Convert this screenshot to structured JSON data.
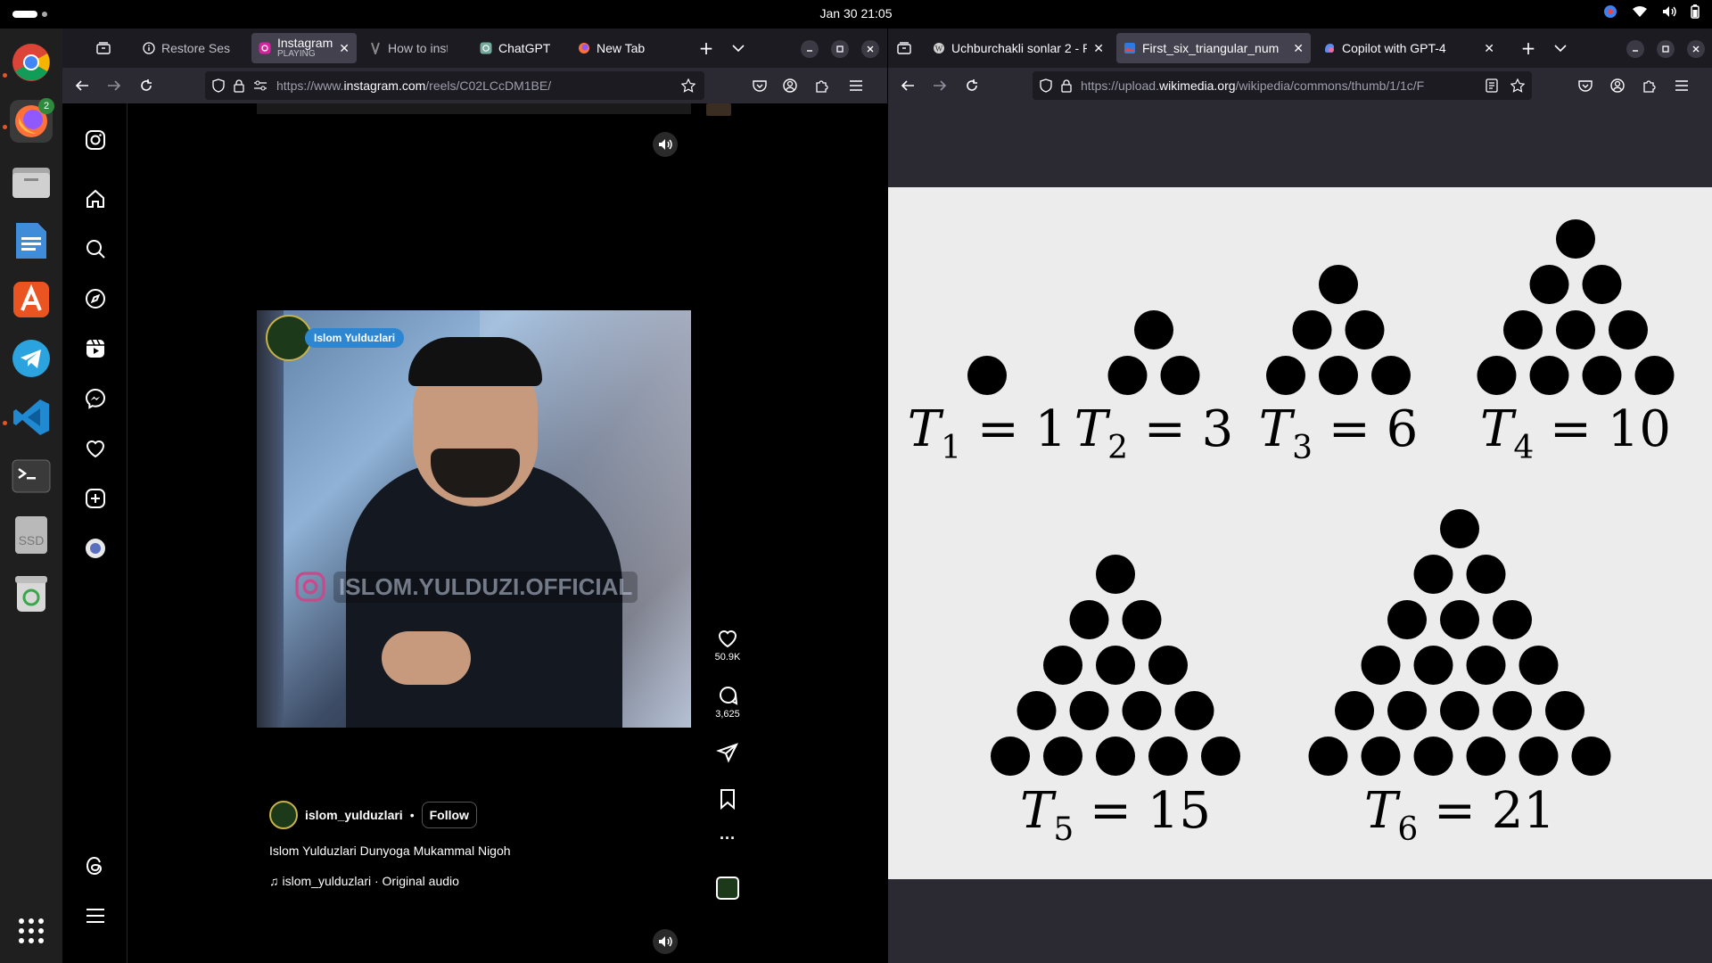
{
  "system": {
    "clock": "Jan 30  21:05",
    "dock": [
      {
        "name": "Google Chrome",
        "icon": "chrome-icon"
      },
      {
        "name": "Firefox",
        "icon": "firefox-icon",
        "badge": "2"
      },
      {
        "name": "Files",
        "icon": "files-icon"
      },
      {
        "name": "LibreOffice Writer",
        "icon": "writer-icon"
      },
      {
        "name": "App Center",
        "icon": "appcenter-icon"
      },
      {
        "name": "Telegram",
        "icon": "telegram-icon"
      },
      {
        "name": "Visual Studio Code",
        "icon": "vscode-icon"
      },
      {
        "name": "Terminal",
        "icon": "terminal-icon"
      },
      {
        "name": "SSD",
        "icon": "ssd-icon",
        "label": "SSD"
      },
      {
        "name": "Trash",
        "icon": "trash-icon"
      },
      {
        "name": "Show Apps",
        "icon": "grid-icon"
      }
    ]
  },
  "left_window": {
    "tabs": [
      {
        "label": "Restore Ses",
        "icon": "info-icon",
        "selected": false
      },
      {
        "label": "Instagram",
        "sub": "PLAYING",
        "icon": "instagram-icon",
        "selected": true
      },
      {
        "label": "How to inst",
        "icon": "page-icon",
        "selected": false
      },
      {
        "label": "ChatGPT",
        "icon": "chatgpt-icon",
        "selected": false
      },
      {
        "label": "New Tab",
        "icon": "firefox-icon",
        "selected": false
      }
    ],
    "url_prefix": "https://www.",
    "url_host": "instagram.com",
    "url_path": "/reels/C02LCcDM1BE/",
    "instagram": {
      "video_overlay": {
        "channel_tag": "Islom Yulduzlari",
        "watermark": "ISLOM.YULDUZI.OFFICIAL"
      },
      "likes": "50.9K",
      "comments": "3,625",
      "username": "islom_yulduzlari",
      "follow_label": "Follow",
      "caption": "Islom Yulduzlari Dunyoga Mukammal Nigoh",
      "audio": "islom_yulduzlari · Original audio"
    }
  },
  "right_window": {
    "tabs": [
      {
        "label": "Uchburchakli sonlar 2 - R",
        "icon": "wiki-icon",
        "selected": false
      },
      {
        "label": "First_six_triangular_num",
        "icon": "image-icon",
        "selected": true
      },
      {
        "label": "Copilot with GPT-4",
        "icon": "copilot-icon",
        "selected": false
      }
    ],
    "url_prefix": "https://upload.",
    "url_host": "wikimedia.org",
    "url_path": "/wikipedia/commons/thumb/1/1c/F",
    "figure": {
      "labels": [
        {
          "sym": "T",
          "sub": "1",
          "val": "1"
        },
        {
          "sym": "T",
          "sub": "2",
          "val": "3"
        },
        {
          "sym": "T",
          "sub": "3",
          "val": "6"
        },
        {
          "sym": "T",
          "sub": "4",
          "val": "10"
        },
        {
          "sym": "T",
          "sub": "5",
          "val": "15"
        },
        {
          "sym": "T",
          "sub": "6",
          "val": "21"
        }
      ]
    }
  }
}
